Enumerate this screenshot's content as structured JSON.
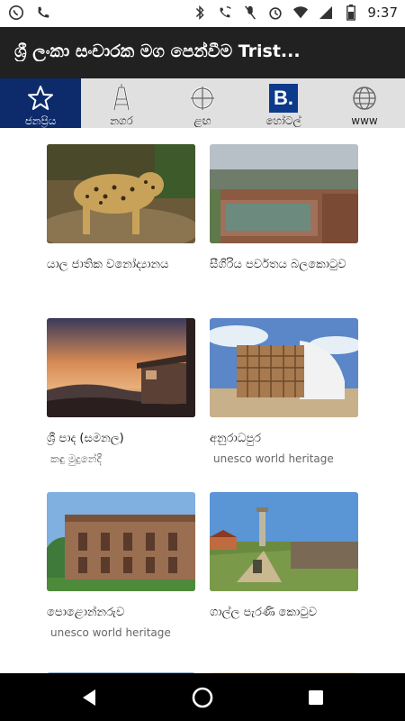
{
  "status_bar": {
    "time": "9:37",
    "icons": [
      "whatsapp-icon",
      "phone-icon",
      "bluetooth-icon",
      "wifi-call-icon",
      "mute-icon",
      "alarm-icon",
      "wifi-icon",
      "signal-icon",
      "battery-icon"
    ]
  },
  "app_bar": {
    "title": "ශ්‍රී ලංකා සංචාරක මග පෙන්වීම Trist..."
  },
  "tabs": [
    {
      "label": "ජනප්‍රිය",
      "icon": "star-icon",
      "active": true
    },
    {
      "label": "නගර",
      "icon": "tower-icon",
      "active": false
    },
    {
      "label": "ළඟ",
      "icon": "crosshair-icon",
      "active": false
    },
    {
      "label": "හෝටල්",
      "icon": "booking-icon",
      "active": false
    },
    {
      "label": "www",
      "icon": "globe-icon",
      "active": false
    }
  ],
  "places": [
    {
      "title": "යාල ජාතික වනෝද්‍යානය",
      "subtitle": ""
    },
    {
      "title": "සීගිරිය පර්වතය බලකොටුව",
      "subtitle": ""
    },
    {
      "title": "ශ්‍රී පාද (සමනල)",
      "subtitle": "කඳු මුදුනේදී"
    },
    {
      "title": "අනුරාධපුර",
      "subtitle": "unesco world heritage"
    },
    {
      "title": "පොළොන්නරුව",
      "subtitle": "unesco world heritage"
    },
    {
      "title": "ගාල්ල පැරණි කොටුව",
      "subtitle": ""
    }
  ],
  "booking_letter": "B.",
  "colors": {
    "appbar": "#212121",
    "active_tab": "#0d2b6b",
    "tab_bg": "#e0e0e0"
  }
}
